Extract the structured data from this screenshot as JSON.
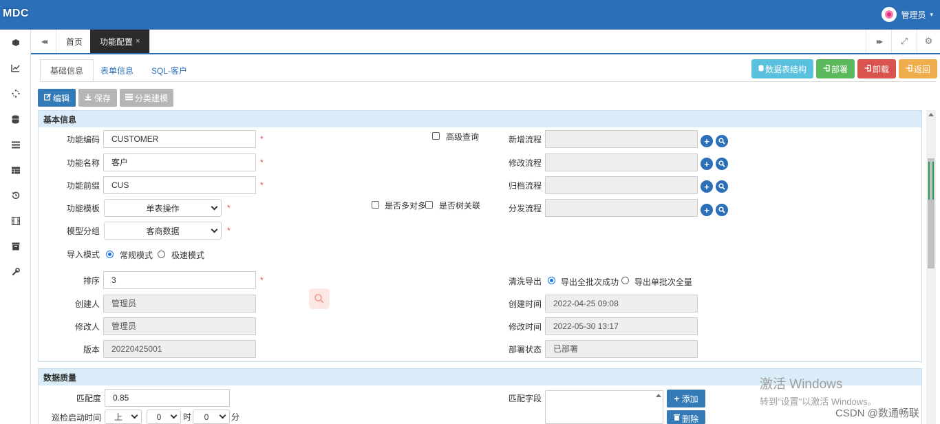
{
  "app": {
    "brand": "MDC",
    "user_name": "管理员",
    "user_caret": "▾"
  },
  "colors": {
    "topbar": "#2a6fb8",
    "btn_info": "#5bc0de",
    "btn_success": "#5cb85c",
    "btn_danger": "#d9534f",
    "btn_warning": "#f0ad4e",
    "btn_primary": "#337ab7",
    "btn_disabled": "#b5b5b5"
  },
  "sidebar": {
    "icons": [
      "cube-icon",
      "line-chart-icon",
      "spinner-icon",
      "database-icon",
      "list-icon",
      "table-icon",
      "history-icon",
      "film-icon",
      "archive-icon",
      "wrench-icon"
    ]
  },
  "tabbar": {
    "back_glyph": "◀◀",
    "forward_glyph": "▶▶",
    "fullscreen_glyph": "⤢",
    "settings_glyph": "⚙",
    "tabs": [
      {
        "label": "首页"
      },
      {
        "label": "功能配置",
        "close": "×"
      }
    ]
  },
  "subtabs": [
    "基础信息",
    "表单信息",
    "SQL-客户"
  ],
  "actions": {
    "table_structure": "数据表结构",
    "deploy": "部署",
    "uninstall": "卸载",
    "back": "返回"
  },
  "toolbar": {
    "edit": "编辑",
    "save": "保存",
    "category": "分类建模"
  },
  "basic_info": {
    "title": "基本信息",
    "required_mark": "*",
    "func_code": {
      "label": "功能编码",
      "value": "CUSTOMER"
    },
    "func_name": {
      "label": "功能名称",
      "value": "客户"
    },
    "func_prefix": {
      "label": "功能前缀",
      "value": "CUS"
    },
    "func_template": {
      "label": "功能模板",
      "value": "单表操作"
    },
    "model_group": {
      "label": "模型分组",
      "value": "客商数据"
    },
    "import_mode": {
      "label": "导入模式",
      "options": [
        "常规模式",
        "极速模式"
      ],
      "selected": "常规模式"
    },
    "order": {
      "label": "排序",
      "value": "3"
    },
    "creator": {
      "label": "创建人",
      "value": "管理员"
    },
    "modifier": {
      "label": "修改人",
      "value": "管理员"
    },
    "version": {
      "label": "版本",
      "value": "20220425001"
    },
    "advanced_query": "高级查询",
    "many_to_many": "是否多对多",
    "tree_related": "是否树关联",
    "add_flow": {
      "label": "新增流程",
      "value": ""
    },
    "modify_flow": {
      "label": "修改流程",
      "value": ""
    },
    "archive_flow": {
      "label": "归档流程",
      "value": ""
    },
    "dispatch_flow": {
      "label": "分发流程",
      "value": ""
    },
    "plus_glyph": "+",
    "clean_export": {
      "label": "清洗导出",
      "options": [
        "导出全批次成功",
        "导出单批次全量"
      ],
      "selected": "导出全批次成功"
    },
    "create_time": {
      "label": "创建时间",
      "value": "2022-04-25 09:08"
    },
    "modify_time": {
      "label": "修改时间",
      "value": "2022-05-30 13:17"
    },
    "deploy_status": {
      "label": "部署状态",
      "value": "已部署"
    }
  },
  "data_quality": {
    "title": "数据质量",
    "match_degree": {
      "label": "匹配度",
      "value": "0.85"
    },
    "patrol_time": {
      "label": "巡检启动时间",
      "select1": "上",
      "select2": "0",
      "hour_unit": "时",
      "select3": "0",
      "minute_unit": "分"
    },
    "match_field": {
      "label": "匹配字段",
      "value": ""
    },
    "add": "添加",
    "delete": "删除"
  },
  "overlay": {
    "activate_title": "激活 Windows",
    "activate_sub": "转到\"设置\"以激活 Windows。",
    "csdn": "CSDN @数通畅联"
  }
}
